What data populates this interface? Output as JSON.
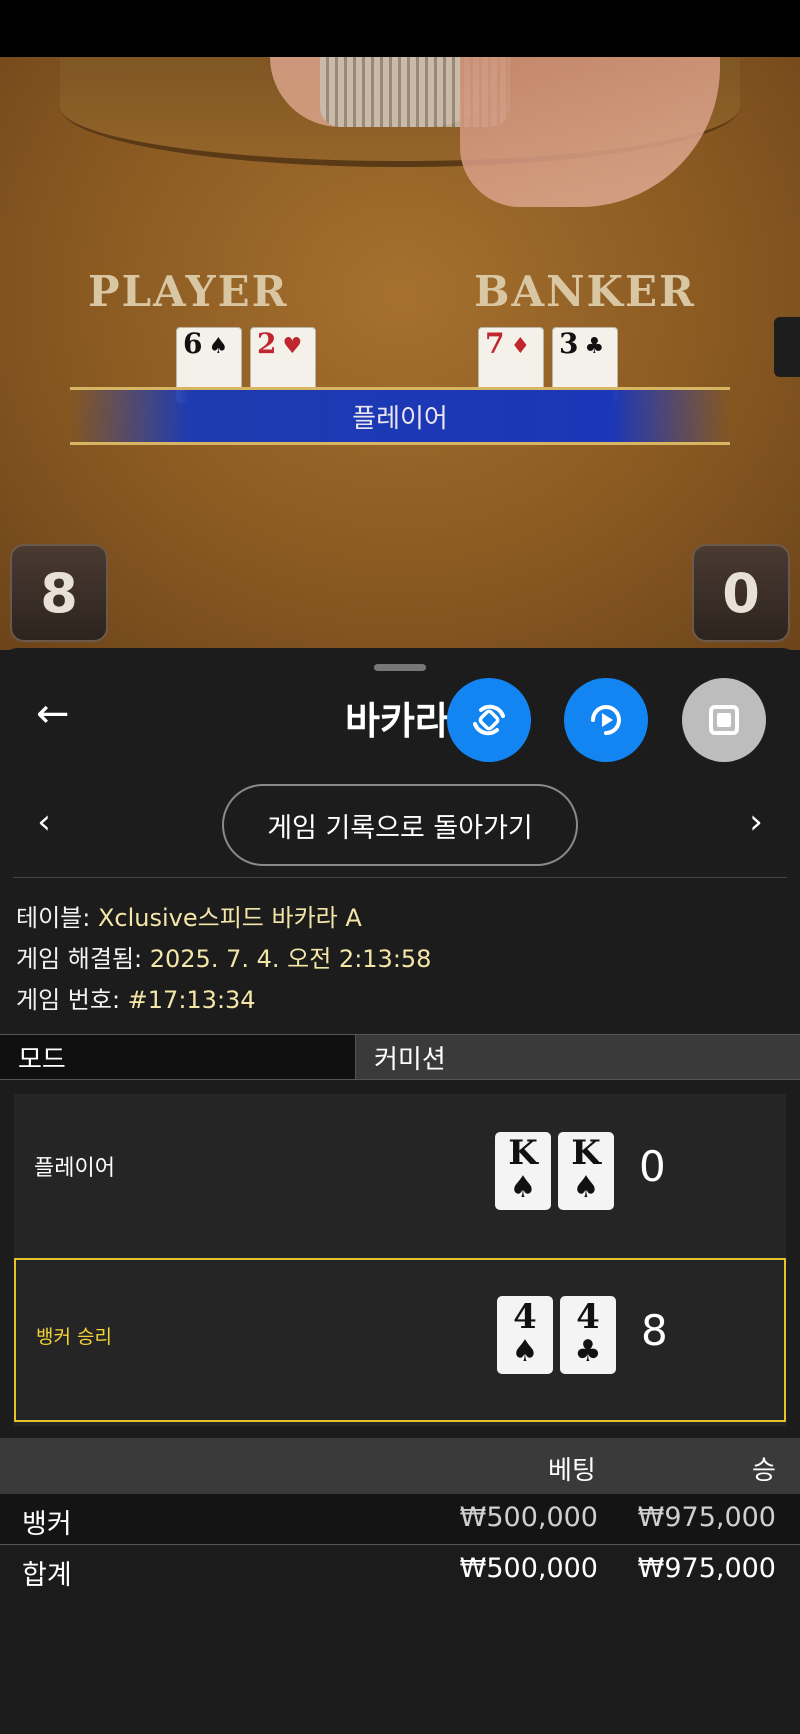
{
  "video": {
    "player_zone": "PLAYER",
    "banker_zone": "BANKER",
    "player_cards": [
      {
        "rank": "6",
        "suit": "♠",
        "color": "black"
      },
      {
        "rank": "2",
        "suit": "♥",
        "color": "red"
      }
    ],
    "banker_cards": [
      {
        "rank": "7",
        "suit": "♦",
        "color": "red"
      },
      {
        "rank": "3",
        "suit": "♣",
        "color": "black"
      }
    ],
    "result_banner": "플레이어",
    "score_left": "8",
    "score_right": "0"
  },
  "sheet": {
    "title": "바카라",
    "back_icon": "←",
    "buttons": [
      {
        "name": "rotate-icon",
        "color": "#1385f2"
      },
      {
        "name": "replay-icon",
        "color": "#1385f2"
      },
      {
        "name": "stop-icon",
        "color": "#bdbdbd"
      }
    ],
    "nav": {
      "prev": "‹",
      "next": "›",
      "history_label": "게임 기록으로 돌아가기"
    },
    "info": {
      "table_label": "테이블: ",
      "table_value": "Xclusive스피드 바카라 A",
      "resolved_label": "게임 해결됨: ",
      "resolved_value": "2025. 7. 4. 오전 2:13:58",
      "number_label": "게임 번호: ",
      "number_value": "#17:13:34"
    },
    "mode": {
      "label": "모드",
      "value": "커미션"
    },
    "results": [
      {
        "label": "플레이어",
        "cards": [
          {
            "rank": "K",
            "suit": "♠"
          },
          {
            "rank": "K",
            "suit": "♠"
          }
        ],
        "score": "0",
        "winner": false
      },
      {
        "label": "뱅커 승리",
        "cards": [
          {
            "rank": "4",
            "suit": "♠"
          },
          {
            "rank": "4",
            "suit": "♣"
          }
        ],
        "score": "8",
        "winner": true
      }
    ],
    "bets": {
      "header_bet": "베팅",
      "header_win": "승",
      "rows": [
        {
          "name": "뱅커",
          "bet": "₩500,000",
          "win": "₩975,000"
        },
        {
          "name": "합계",
          "bet": "₩500,000",
          "win": "₩975,000"
        }
      ]
    }
  },
  "colors": {
    "accent_blue": "#1385f2",
    "winner_yellow": "#e3c22c",
    "info_value": "#f3e6a8"
  }
}
